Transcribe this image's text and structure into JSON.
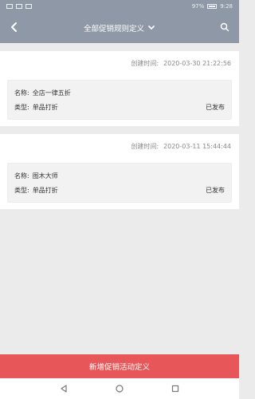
{
  "status": {
    "left_text": "",
    "right_text": "97%",
    "time": "9:28"
  },
  "header": {
    "title": "全部促销规则定义"
  },
  "icons": {
    "back": "back-arrow-icon",
    "search": "search-icon",
    "dropdown": "chevron-down-icon"
  },
  "list": [
    {
      "time_label": "创建时间:",
      "time_value": "2020-03-30 21:22:56",
      "name_label": "名称:",
      "name_value": "全店一律五折",
      "type_label": "类型:",
      "type_value": "单品打折",
      "status": "已发布"
    },
    {
      "time_label": "创建时间:",
      "time_value": "2020-03-11 15:44:44",
      "name_label": "名称:",
      "name_value": "图木大师",
      "type_label": "类型:",
      "type_value": "单品打折",
      "status": "已发布"
    }
  ],
  "footer": {
    "button_label": "新增促销活动定义"
  }
}
